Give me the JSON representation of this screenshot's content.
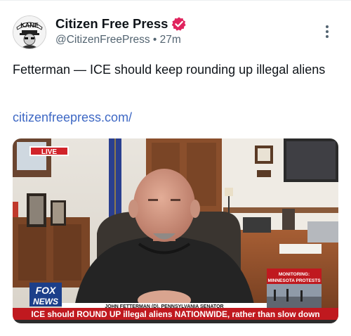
{
  "author": {
    "name": "Citizen Free Press",
    "handle": "@CitizenFreePress",
    "separator": "•",
    "time": "27m",
    "verified": true,
    "avatar_text": "KANE"
  },
  "tweet": {
    "text": "Fetterman — ICE should keep rounding up illegal aliens",
    "link": "citizenfreepress.com/"
  },
  "media": {
    "live_badge": "LIVE",
    "network_line1": "FOX",
    "network_line2": "NEWS",
    "monitoring_line1": "MONITORING:",
    "monitoring_line2": "MINNESOTA PROTESTS",
    "lower_third_name": "JOHN FETTERMAN (D), PENNSYLVANIA SENATOR",
    "ticker": "ICE should ROUND UP illegal aliens NATIONWIDE, rather than slow down"
  },
  "icons": {
    "verified": "verified-badge-icon",
    "more": "more-options-icon"
  },
  "colors": {
    "link": "#3e68c4",
    "verified": "#e0245e",
    "live": "#d1232a",
    "ticker": "#c0191f"
  }
}
